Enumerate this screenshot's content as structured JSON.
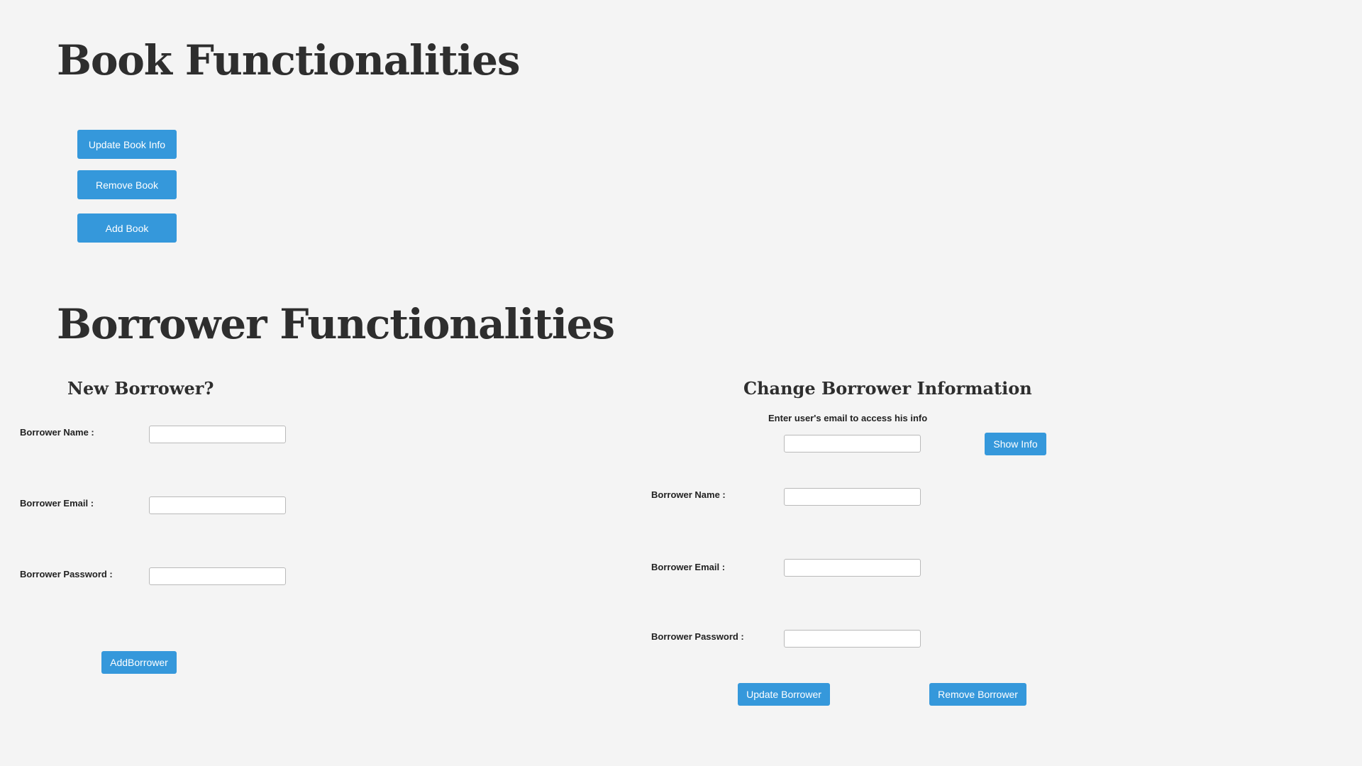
{
  "book_section": {
    "title": "Book Functionalities",
    "buttons": {
      "update_book_info": "Update Book Info",
      "remove_book": "Remove Book",
      "add_book": "Add Book"
    }
  },
  "borrower_section": {
    "title": "Borrower Functionalities",
    "new_borrower": {
      "heading": "New Borrower?",
      "name_label": "Borrower Name :",
      "email_label": "Borrower Email :",
      "password_label": "Borrower Password :",
      "name_value": "",
      "email_value": "",
      "password_value": "",
      "add_button": "AddBorrower"
    },
    "change_borrower": {
      "heading": "Change Borrower Information",
      "hint": "Enter user's email to access his info",
      "lookup_email_value": "",
      "show_info_button": "Show Info",
      "name_label": "Borrower Name :",
      "email_label": "Borrower Email :",
      "password_label": "Borrower Password :",
      "name_value": "",
      "email_value": "",
      "password_value": "",
      "update_button": "Update Borrower",
      "remove_button": "Remove Borrower"
    }
  },
  "colors": {
    "background": "#f4f4f4",
    "button": "#3598db",
    "heading": "#2e2e2e"
  }
}
